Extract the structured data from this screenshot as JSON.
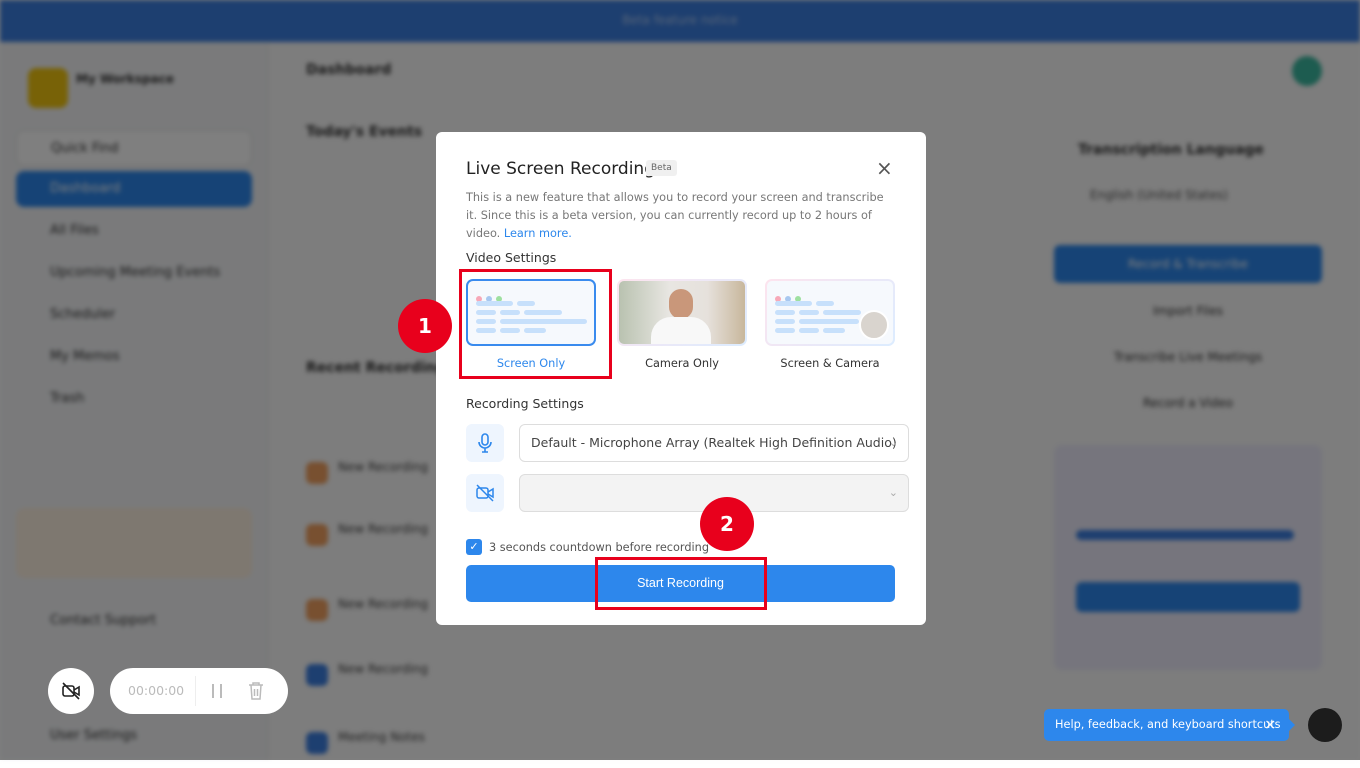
{
  "background": {
    "banner": "Beta feature notice",
    "workspace_name": "My Workspace",
    "nav": [
      "Quick Find",
      "Dashboard",
      "All Files",
      "Upcoming Meeting Events",
      "Scheduler",
      "My Memos",
      "Trash"
    ],
    "nav_bottom": [
      "Contact Support",
      "User Settings"
    ],
    "page_title": "Dashboard",
    "todays_events": "Today's Events",
    "recent_recordings": "Recent Recordings",
    "recordings": [
      "New Recording",
      "New Recording",
      "New Recording",
      "New Recording",
      "Meeting Notes"
    ],
    "transcription_language": "Transcription Language",
    "language_value": "English (United States)",
    "right_actions": [
      "Record & Transcribe",
      "Import Files",
      "Transcribe Live Meetings",
      "Record a Video"
    ]
  },
  "modal": {
    "title": "Live Screen Recording",
    "beta": "Beta",
    "close": "×",
    "description": "This is a new feature that allows you to record your screen and transcribe it. Since this is a beta version, you can currently record up to 2 hours of video.",
    "learn_more": "Learn more.",
    "video_settings": "Video Settings",
    "video_options": [
      {
        "label": "Screen Only",
        "selected": true
      },
      {
        "label": "Camera Only",
        "selected": false
      },
      {
        "label": "Screen & Camera",
        "selected": false
      }
    ],
    "recording_settings": "Recording Settings",
    "microphone_value": "Default - Microphone Array (Realtek High Definition Audio)",
    "camera_value": "",
    "countdown_checked": true,
    "countdown_label": "3 seconds countdown before recording",
    "start_button": "Start Recording"
  },
  "annotations": {
    "step1": "1",
    "step2": "2",
    "color": "#e8001c"
  },
  "recorder": {
    "timer": "00:00:00"
  },
  "help_tooltip": {
    "text": "Help, feedback, and keyboard shortcuts",
    "close": "×"
  },
  "colors": {
    "accent": "#2d87ec",
    "annotation": "#e8001c"
  }
}
